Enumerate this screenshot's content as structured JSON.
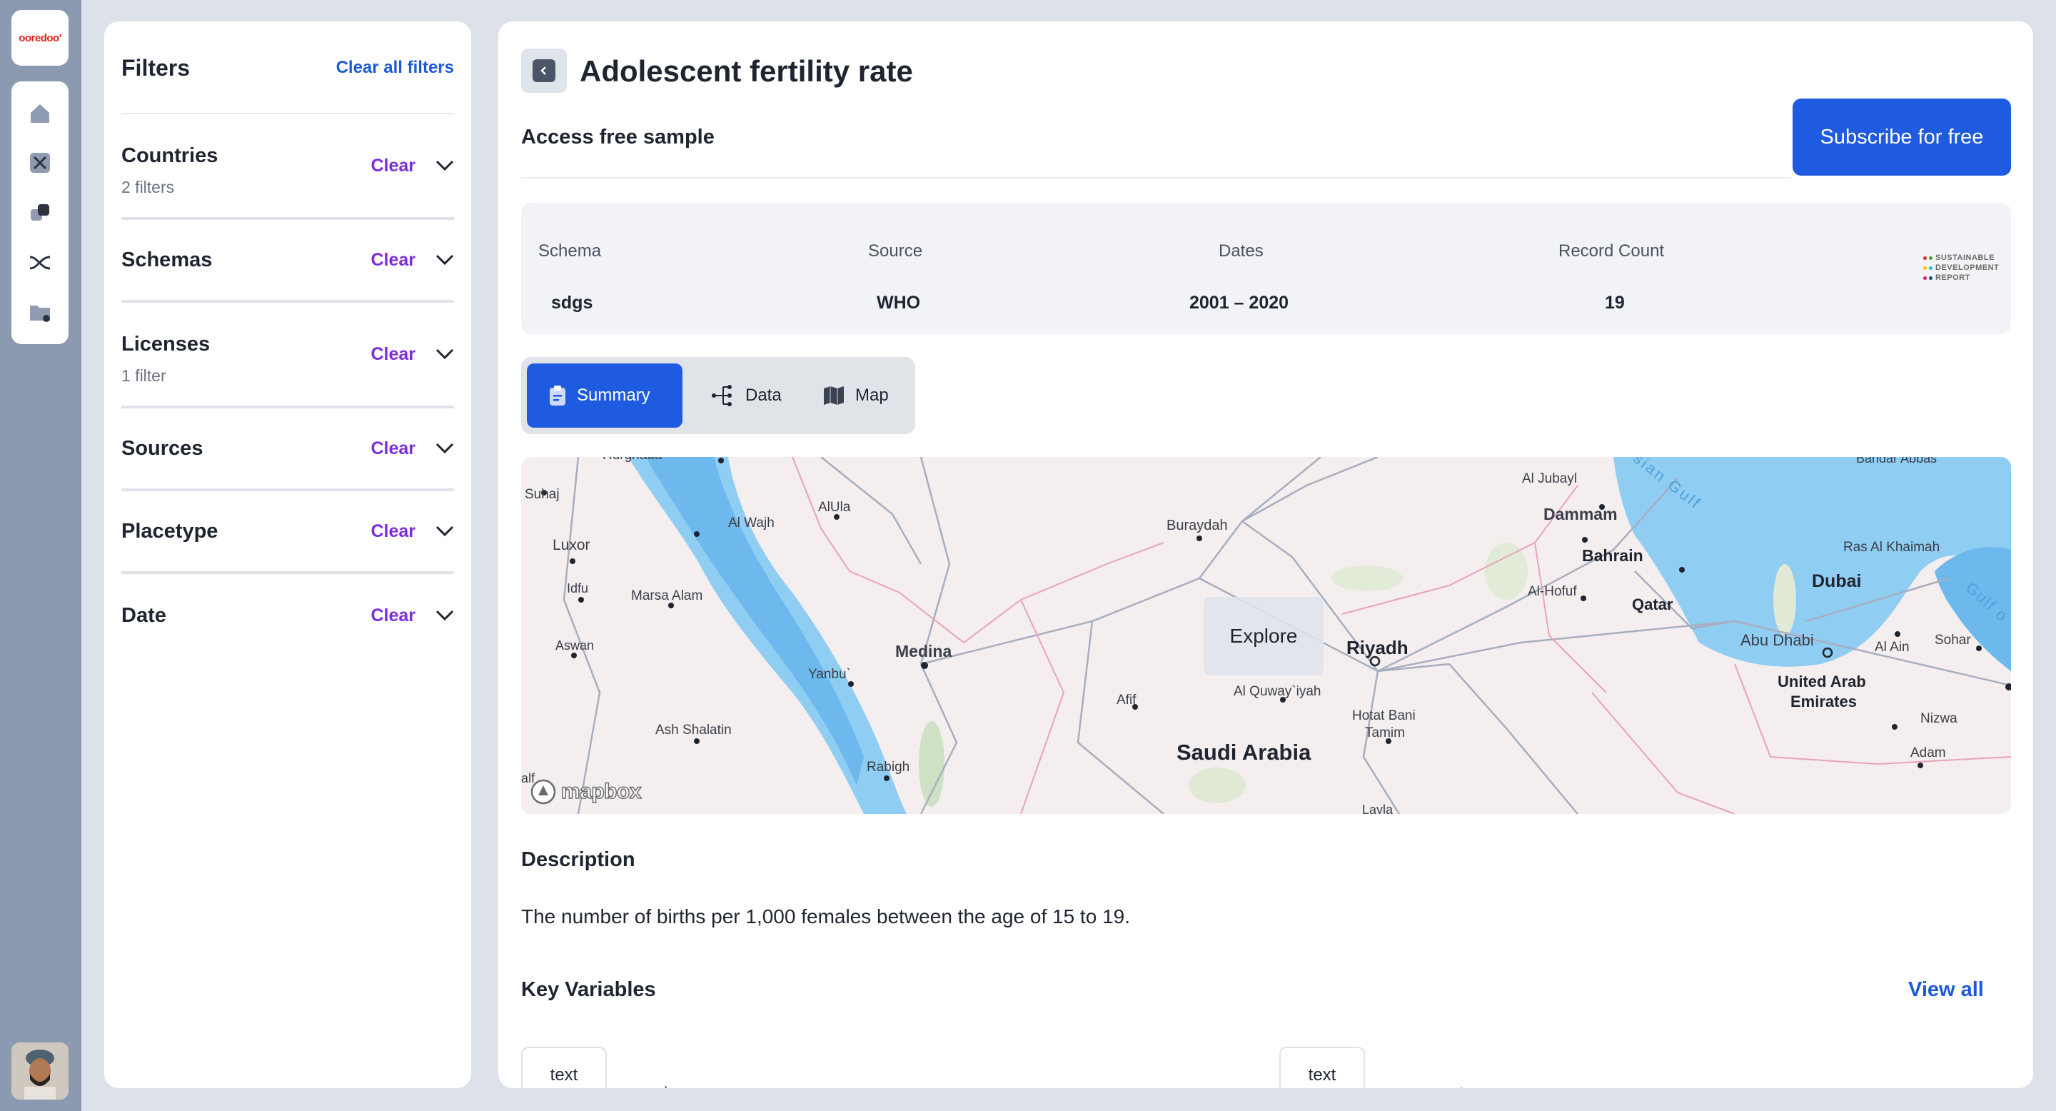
{
  "brand": {
    "logo_text": "ooredoo'"
  },
  "filters": {
    "title": "Filters",
    "clear_all": "Clear all filters",
    "groups": [
      {
        "title": "Countries",
        "subtitle": "2 filters",
        "clear": "Clear"
      },
      {
        "title": "Schemas",
        "subtitle": "",
        "clear": "Clear"
      },
      {
        "title": "Licenses",
        "subtitle": "1 filter",
        "clear": "Clear"
      },
      {
        "title": "Sources",
        "subtitle": "",
        "clear": "Clear"
      },
      {
        "title": "Placetype",
        "subtitle": "",
        "clear": "Clear"
      },
      {
        "title": "Date",
        "subtitle": "",
        "clear": "Clear"
      }
    ]
  },
  "main": {
    "title": "Adolescent fertility rate",
    "sample_label": "Access free sample",
    "subscribe_label": "Subscribe for free",
    "meta": {
      "schema_label": "Schema",
      "schema_value": "sdgs",
      "source_label": "Source",
      "source_value": "WHO",
      "dates_label": "Dates",
      "dates_value": "2001 – 2020",
      "count_label": "Record Count",
      "count_value": "19",
      "logo_lines": [
        "SUSTAINABLE",
        "DEVELOPMENT",
        "REPORT"
      ]
    },
    "tabs": [
      {
        "label": "Summary",
        "icon": "clipboard-icon",
        "active": true
      },
      {
        "label": "Data",
        "icon": "data-tree-icon",
        "active": false
      },
      {
        "label": "Map",
        "icon": "map-icon",
        "active": false
      }
    ],
    "map": {
      "explore_label": "Explore",
      "attribution": "mapbox",
      "labels": {
        "hurghada": "Hurghada",
        "suhaj": "Suhaj",
        "luxor": "Luxor",
        "idfu": "Idfu",
        "aswan": "Aswan",
        "marsa_alam": "Marsa Alam",
        "ash_shalatin": "Ash Shalatin",
        "alfa": "alf",
        "al_wajh": "Al Wajh",
        "alula": "AlUla",
        "medina": "Medina",
        "yanbu": "Yanbu`",
        "rabigh": "Rabigh",
        "buraydah": "Buraydah",
        "afif": "Afif",
        "riyadh": "Riyadh",
        "al_quwayiyah": "Al Quway`iyah",
        "saudi_arabia": "Saudi Arabia",
        "hotat_bani_tamim_1": "Hotat Bani",
        "hotat_bani_tamim_2": "Tamim",
        "layla": "Layla",
        "al_jubayl": "Al Jubayl",
        "dammam": "Dammam",
        "persian_gulf": "ersian Gulf",
        "bahrain": "Bahrain",
        "al_hofuf": "Al-Hofuf",
        "qatar": "Qatar",
        "bandar_abbas": "Bandar Abbas",
        "ras_al_khaimah": "Ras Al Khaimah",
        "dubai": "Dubai",
        "abu_dhabi": "Abu Dhabi",
        "al_ain": "Al Ain",
        "sohar": "Sohar",
        "uae_1": "United Arab",
        "uae_2": "Emirates",
        "nizwa": "Nizwa",
        "adam": "Adam",
        "gulf_of_oman": "Gulf o"
      }
    },
    "description_heading": "Description",
    "description_text": "The number of births per 1,000 females between the age of 15 to 19.",
    "key_variables_heading": "Key Variables",
    "view_all_label": "View all",
    "variables": [
      {
        "type": "text",
        "name": "iso"
      },
      {
        "type": "text",
        "name": "country"
      }
    ]
  },
  "colors": {
    "accent": "#1f5be0",
    "clear": "#7a2ee0",
    "link": "#1c5ad8",
    "water": "#7fc4ef"
  }
}
